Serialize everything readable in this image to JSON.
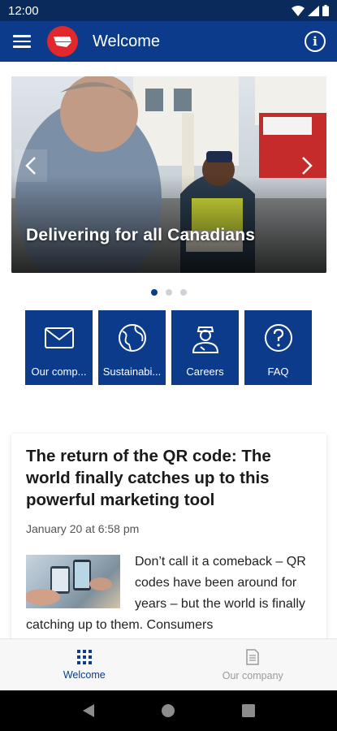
{
  "status_bar": {
    "time": "12:00"
  },
  "app_bar": {
    "title": "Welcome"
  },
  "carousel": {
    "caption": "Delivering for all Canadians",
    "slide_count": 3,
    "active_slide": 1
  },
  "tiles": [
    {
      "label": "Our comp...",
      "icon": "envelope-icon"
    },
    {
      "label": "Sustainabi...",
      "icon": "globe-icon"
    },
    {
      "label": "Careers",
      "icon": "carrier-person-icon"
    },
    {
      "label": "FAQ",
      "icon": "question-circle-icon"
    }
  ],
  "news": {
    "title": "The return of the QR code: The world finally catches up to this powerful marketing tool",
    "date": "January 20 at 6:58 pm",
    "excerpt": "Don’t call it a comeback – QR codes have been around for years – but the world is finally catching up to them. Consumers"
  },
  "bottom_nav": [
    {
      "label": "Welcome",
      "active": true
    },
    {
      "label": "Our company",
      "active": false
    }
  ],
  "colors": {
    "brand_blue": "#0b3b8a",
    "status_bar": "#0a2a5c",
    "logo_red": "#e0282d"
  }
}
